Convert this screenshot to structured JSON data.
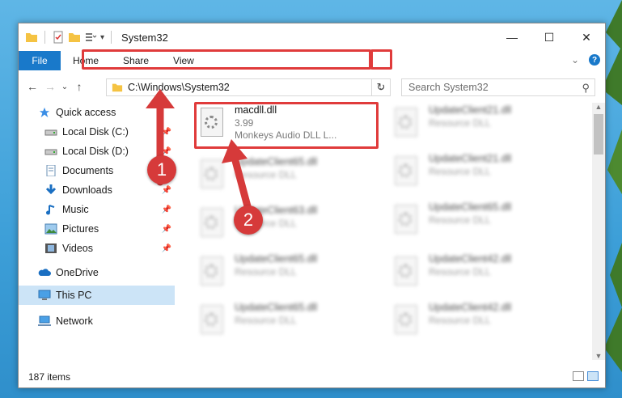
{
  "window": {
    "title": "System32",
    "controls": {
      "minimize": "—",
      "maximize": "☐",
      "close": "✕"
    }
  },
  "ribbon": {
    "tabs": [
      "File",
      "Home",
      "Share",
      "View"
    ],
    "expand_glyph": "⌄",
    "help_glyph": "?"
  },
  "nav": {
    "back": "←",
    "forward": "→",
    "recent": "⌄",
    "up": "↑"
  },
  "address": {
    "path": "C:\\Windows\\System32",
    "dropdown": "⌄",
    "refresh": "↻"
  },
  "search": {
    "placeholder": "Search System32",
    "icon": "⚲"
  },
  "sidebar": {
    "items": [
      {
        "label": "Quick access",
        "icon": "star-icon"
      },
      {
        "label": "Local Disk (C:)",
        "icon": "drive-icon",
        "pinned": true
      },
      {
        "label": "Local Disk (D:)",
        "icon": "drive-icon",
        "pinned": true
      },
      {
        "label": "Documents",
        "icon": "documents-icon",
        "pinned": true
      },
      {
        "label": "Downloads",
        "icon": "downloads-icon",
        "pinned": true
      },
      {
        "label": "Music",
        "icon": "music-icon",
        "pinned": true
      },
      {
        "label": "Pictures",
        "icon": "pictures-icon",
        "pinned": true
      },
      {
        "label": "Videos",
        "icon": "videos-icon",
        "pinned": true
      },
      {
        "label": "OneDrive",
        "icon": "onedrive-icon"
      },
      {
        "label": "This PC",
        "icon": "computer-icon",
        "selected": true
      },
      {
        "label": "Network",
        "icon": "network-icon"
      }
    ]
  },
  "files": [
    {
      "name": "macdll.dll",
      "sub1": "3.99",
      "sub2": "Monkeys Audio DLL L..."
    },
    {
      "name": "UpdateClient21.dll",
      "sub1": "Resource DLL"
    },
    {
      "name": "UpdateClient65.dll",
      "sub1": "Resource DLL"
    },
    {
      "name": "UpdateClient21.dll",
      "sub1": "Resource DLL"
    },
    {
      "name": "UpdateClient63.dll",
      "sub1": "Resource DLL"
    },
    {
      "name": "UpdateClient65.dll",
      "sub1": "Resource DLL"
    },
    {
      "name": "UpdateClient65.dll",
      "sub1": "Resource DLL"
    },
    {
      "name": "UpdateClient42.dll",
      "sub1": "Resource DLL"
    },
    {
      "name": "UpdateClient65.dll",
      "sub1": "Resource DLL"
    },
    {
      "name": "UpdateClient42.dll",
      "sub1": "Resource DLL"
    }
  ],
  "status": {
    "item_count": "187 items"
  },
  "annotations": {
    "step1": "1",
    "step2": "2",
    "highlight_color": "#e03b3b"
  },
  "colors": {
    "accent": "#1979ca",
    "selection": "#cce4f7"
  }
}
